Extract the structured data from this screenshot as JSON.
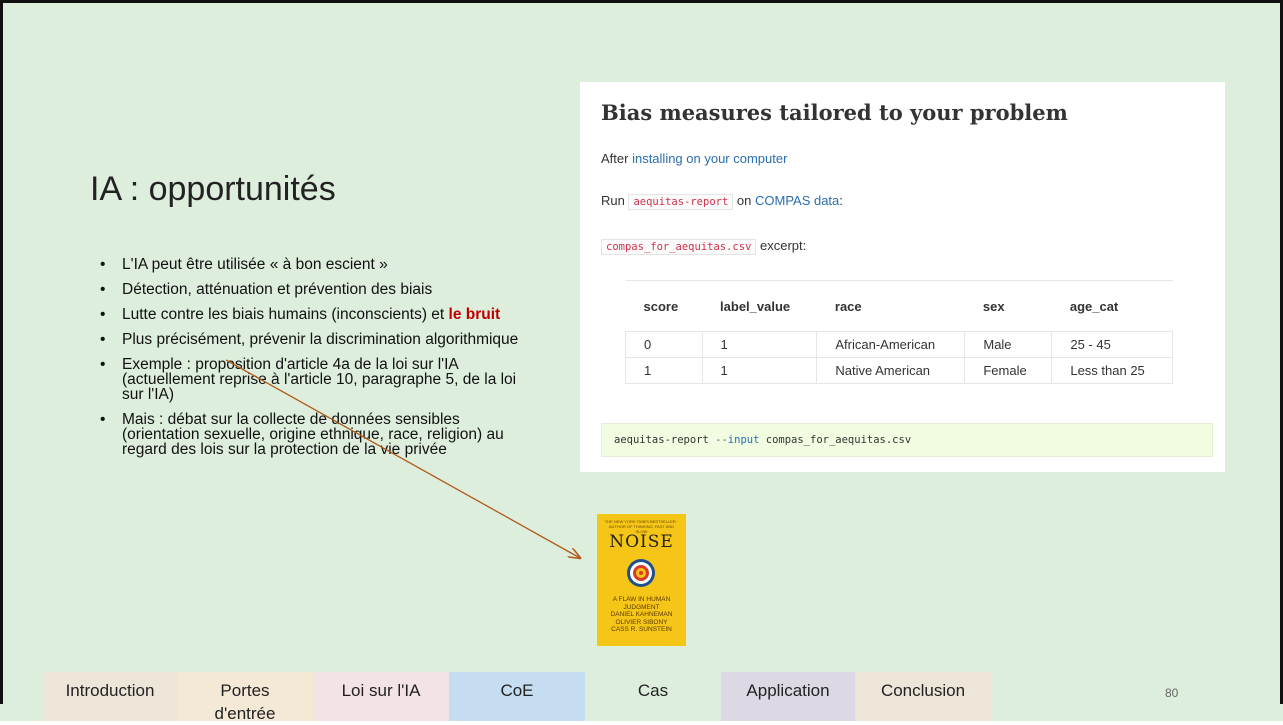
{
  "slide": {
    "title": "IA : opportunités",
    "page_number": "80",
    "bullets": [
      {
        "text": "L'IA peut être utilisée « à bon escient »"
      },
      {
        "text": "Détection, atténuation et prévention des biais"
      },
      {
        "text": "Lutte contre les biais humains (inconscients) et ",
        "highlight": "le bruit"
      },
      {
        "text": "Plus précisément, prévenir la discrimination algorithmique"
      },
      {
        "text": "Exemple : proposition d'article 4a de la loi sur l'IA (actuellement reprise à l'article 10, paragraphe 5, de la loi sur l'IA)"
      },
      {
        "text": "Mais : débat sur la collecte de données sensibles (orientation sexuelle, origine ethnique, race, religion) au regard des lois sur la protection de la vie privée"
      }
    ],
    "bullet_symbol": "•",
    "colors": {
      "background": "#ddeedd",
      "highlight": "#c00000",
      "arrow": "#b05a1a"
    }
  },
  "screenshot": {
    "heading": "Bias measures tailored to your problem",
    "after_prefix": "After ",
    "after_link": "installing on your computer",
    "run_prefix": "Run ",
    "run_code": "aequitas-report",
    "run_mid": " on ",
    "run_link": "COMPAS data",
    "run_suffix": ":",
    "file_code": "compas_for_aequitas.csv",
    "file_suffix": " excerpt:",
    "table": {
      "headers": [
        "score",
        "label_value",
        "race",
        "sex",
        "age_cat"
      ],
      "rows": [
        [
          "0",
          "1",
          "African-American",
          "Male",
          "25 - 45"
        ],
        [
          "1",
          "1",
          "Native American",
          "Female",
          "Less than 25"
        ]
      ]
    },
    "command_prefix": "aequitas-report ",
    "command_flag": "--input",
    "command_arg": " compas_for_aequitas.csv"
  },
  "book": {
    "header": "THE NEW YORK TIMES BESTSELLER · AUTHOR OF THINKING, FAST AND SLOW",
    "title": "NOISE",
    "subtitle": "A FLAW IN HUMAN JUDGMENT",
    "authors": [
      "DANIEL KAHNEMAN",
      "OLIVIER SIBONY",
      "CASS R. SUNSTEIN"
    ]
  },
  "nav_tabs": [
    {
      "label": "Introduction",
      "color": "#ece5d8"
    },
    {
      "label": "Portes d'entrée",
      "color": "#f4e8d6"
    },
    {
      "label": "Loi sur l'IA",
      "color": "#f3e3e5"
    },
    {
      "label": "CoE",
      "color": "#c6ddf1"
    },
    {
      "label": "Cas",
      "color": "#ddeedd"
    },
    {
      "label": "Application",
      "color": "#dcd9e4"
    },
    {
      "label": "Conclusion",
      "color": "#ece5d8"
    }
  ]
}
